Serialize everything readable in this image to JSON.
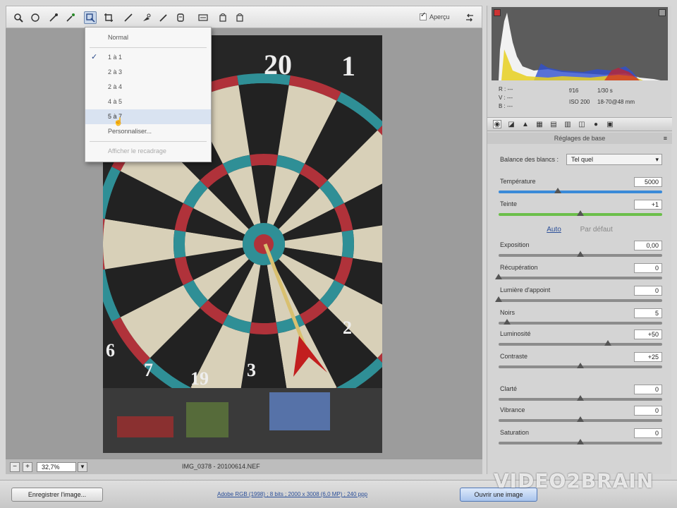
{
  "toolbar": {
    "tools": [
      "zoom-icon",
      "hand-icon",
      "white-balance-icon",
      "color-sampler-icon",
      "target-adjust-icon",
      "crop-icon",
      "straighten-icon",
      "spot-removal-icon",
      "red-eye-icon",
      "preferences-icon",
      "rotate-left-icon",
      "rotate-right-icon"
    ],
    "preview_label": "Aperçu"
  },
  "zoom_menu": {
    "items": [
      {
        "label": "Normal",
        "checked": false,
        "highlighted": false,
        "disabled": false
      },
      {
        "label": "1 à 1",
        "checked": true,
        "highlighted": false,
        "disabled": false
      },
      {
        "label": "2 à 3",
        "checked": false,
        "highlighted": false,
        "disabled": false
      },
      {
        "label": "2 à 4",
        "checked": false,
        "highlighted": false,
        "disabled": false
      },
      {
        "label": "4 à 5",
        "checked": false,
        "highlighted": false,
        "disabled": false
      },
      {
        "label": "5 à 7",
        "checked": false,
        "highlighted": true,
        "disabled": false
      },
      {
        "label": "Personnaliser...",
        "checked": false,
        "highlighted": false,
        "disabled": false
      },
      {
        "label": "Afficher le recadrage",
        "checked": false,
        "highlighted": false,
        "disabled": true
      }
    ]
  },
  "photo": {
    "numbers": [
      "20",
      "1",
      "2",
      "6",
      "7",
      "19",
      "3"
    ]
  },
  "statusbar": {
    "zoom_value": "32,7%",
    "filename": "IMG_0378 - 20100614.NEF"
  },
  "readout": {
    "r": "R : ---",
    "g": "V : ---",
    "b": "B : ---",
    "f": "f/16",
    "speed": "1/30 s",
    "iso": "ISO 200",
    "lens": "18-70@48 mm"
  },
  "panel": {
    "title": "Réglages de base",
    "wb_label": "Balance des blancs :",
    "wb_value": "Tel quel",
    "auto_label": "Auto",
    "default_label": "Par défaut",
    "sliders": [
      {
        "label": "Température",
        "value": "5000",
        "level": 0.36,
        "track": "#3a8ad8"
      },
      {
        "label": "Teinte",
        "value": "+1",
        "level": 0.5,
        "track": "#6bbf4a"
      },
      {
        "label": "Exposition",
        "value": "0,00",
        "level": 0.5,
        "track": "#8c8c8c"
      },
      {
        "label": "Récupération",
        "value": "0",
        "level": 0.0,
        "track": "#8c8c8c"
      },
      {
        "label": "Lumière d'appoint",
        "value": "0",
        "level": 0.0,
        "track": "#8c8c8c"
      },
      {
        "label": "Noirs",
        "value": "5",
        "level": 0.05,
        "track": "#8c8c8c"
      },
      {
        "label": "Luminosité",
        "value": "+50",
        "level": 0.67,
        "track": "#8c8c8c"
      },
      {
        "label": "Contraste",
        "value": "+25",
        "level": 0.5,
        "track": "#8c8c8c"
      },
      {
        "label": "Clarté",
        "value": "0",
        "level": 0.5,
        "track": "#8c8c8c"
      },
      {
        "label": "Vibrance",
        "value": "0",
        "level": 0.5,
        "track": "#8c8c8c"
      },
      {
        "label": "Saturation",
        "value": "0",
        "level": 0.5,
        "track": "#8c8c8c"
      }
    ]
  },
  "bottombar": {
    "save_label": "Enregistrer l'image...",
    "workflow_link": "Adobe RGB (1998) ; 8 bits ; 2000 x 3008 (6,0 MP) ; 240 ppp",
    "open_label": "Ouvrir une image"
  },
  "watermark": "VIDEO2BRAIN"
}
